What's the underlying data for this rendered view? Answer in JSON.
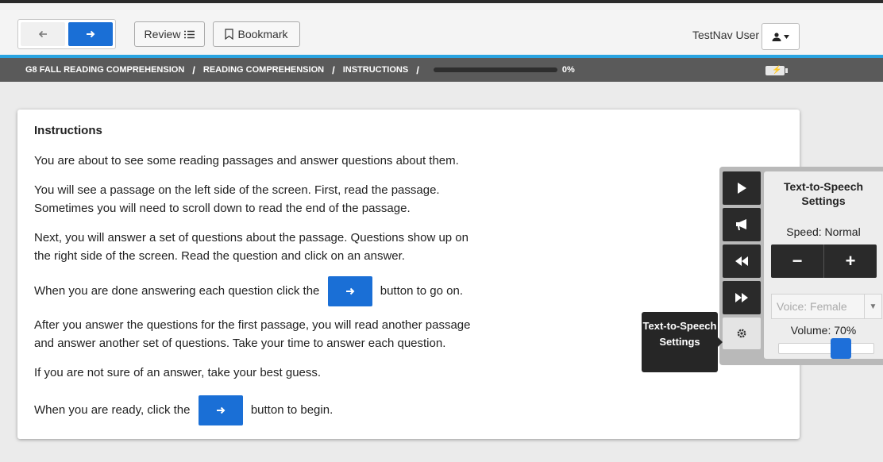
{
  "toolbar": {
    "back_icon": "arrow-left-icon",
    "forward_icon": "arrow-right-icon",
    "review_label": "Review",
    "review_icon": "list-icon",
    "bookmark_label": "Bookmark",
    "bookmark_icon": "bookmark-icon",
    "user_name": "TestNav User",
    "user_icon": "person-icon",
    "user_caret": "chevron-down-icon",
    "accent_color": "#1a6fd6"
  },
  "breadcrumb": {
    "items": [
      "G8 FALL READING COMPREHENSION",
      "READING COMPREHENSION",
      "INSTRUCTIONS"
    ],
    "separator": "/",
    "progress_value": 0,
    "progress_text": "0%",
    "battery_icon": "battery-charging-icon"
  },
  "content": {
    "heading": "Instructions",
    "p1": "You are about to see some reading passages and answer questions about them.",
    "p2_line1": "You will see a passage on the left side of the screen. First, read the passage.",
    "p2_line2": "Sometimes you will need to scroll down to read the end of the passage.",
    "p3_line1": "Next, you will answer a set of questions about the passage. Questions show up on",
    "p3_line2": "the right side of the screen. Read the question and click on an answer.",
    "p4_before": "When you are done answering each question click the",
    "p4_after": "button to go on.",
    "p5_line1": "After you answer the questions for the first passage, you will read another passage",
    "p5_line2": "and answer another set of questions. Take your time to answer each question.",
    "p6": "If you are not sure of an answer, take your best guess.",
    "p7_before": "When you are ready, click the",
    "p7_after": "button to begin."
  },
  "tts": {
    "controls": [
      "play-icon",
      "megaphone-icon",
      "rewind-icon",
      "fast-forward-icon",
      "gear-icon"
    ],
    "title": "Text-to-Speech Settings",
    "speed_label": "Speed: Normal",
    "minus_label": "−",
    "plus_label": "+",
    "voice_label": "Voice: Female",
    "volume_label": "Volume: 70%",
    "volume_value": 0.7,
    "tooltip": "Text-to-Speech Settings"
  }
}
